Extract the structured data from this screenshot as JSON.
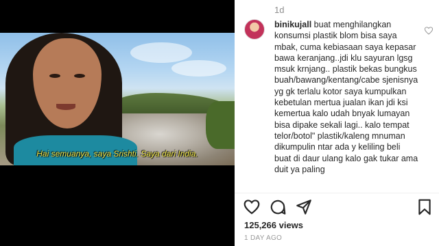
{
  "video": {
    "subtitle": "Hai semuanya, saya Srishti. Saya dari India."
  },
  "sidebar": {
    "top_age": "1d",
    "comment": {
      "username": "binikujall",
      "text": "buat menghilangkan konsumsi plastik blom bisa saya mbak, cuma kebiasaan saya kepasar bawa keranjang..jdi klu sayuran lgsg msuk krnjang.. plastik bekas bungkus buah/bawang/kentang/cabe sjenisnya yg gk terlalu kotor saya kumpulkan kebetulan mertua jualan ikan jdi ksi kemertua kalo udah bnyak lumayan bisa dipake sekali lagi.. kalo tempat telor/botol\" plastik/kaleng mnuman dikumpulin ntar ada y keliling beli buat di daur ulang kalo gak tukar ama duit ya paling"
    },
    "actions": {
      "like_icon": "heart-icon",
      "comment_icon": "comment-icon",
      "share_icon": "share-icon",
      "save_icon": "bookmark-icon"
    },
    "views": "125,266 views",
    "posted_age": "1 DAY AGO"
  }
}
